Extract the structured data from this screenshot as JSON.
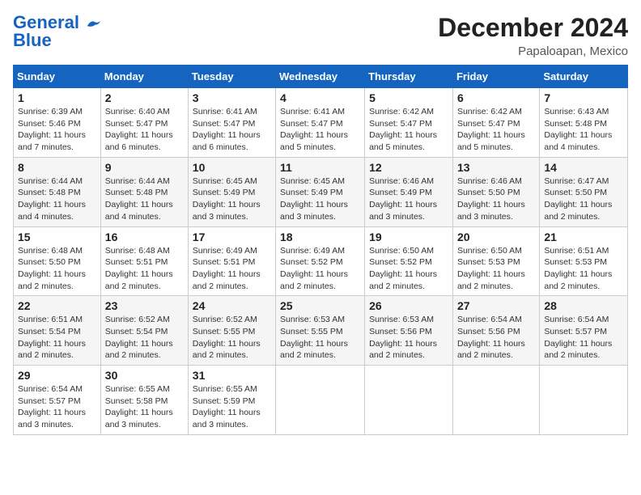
{
  "header": {
    "logo_line1": "General",
    "logo_line2": "Blue",
    "month": "December 2024",
    "location": "Papaloapan, Mexico"
  },
  "weekdays": [
    "Sunday",
    "Monday",
    "Tuesday",
    "Wednesday",
    "Thursday",
    "Friday",
    "Saturday"
  ],
  "weeks": [
    [
      {
        "day": "1",
        "sunrise": "6:39 AM",
        "sunset": "5:46 PM",
        "daylight": "11 hours and 7 minutes."
      },
      {
        "day": "2",
        "sunrise": "6:40 AM",
        "sunset": "5:47 PM",
        "daylight": "11 hours and 6 minutes."
      },
      {
        "day": "3",
        "sunrise": "6:41 AM",
        "sunset": "5:47 PM",
        "daylight": "11 hours and 6 minutes."
      },
      {
        "day": "4",
        "sunrise": "6:41 AM",
        "sunset": "5:47 PM",
        "daylight": "11 hours and 5 minutes."
      },
      {
        "day": "5",
        "sunrise": "6:42 AM",
        "sunset": "5:47 PM",
        "daylight": "11 hours and 5 minutes."
      },
      {
        "day": "6",
        "sunrise": "6:42 AM",
        "sunset": "5:47 PM",
        "daylight": "11 hours and 5 minutes."
      },
      {
        "day": "7",
        "sunrise": "6:43 AM",
        "sunset": "5:48 PM",
        "daylight": "11 hours and 4 minutes."
      }
    ],
    [
      {
        "day": "8",
        "sunrise": "6:44 AM",
        "sunset": "5:48 PM",
        "daylight": "11 hours and 4 minutes."
      },
      {
        "day": "9",
        "sunrise": "6:44 AM",
        "sunset": "5:48 PM",
        "daylight": "11 hours and 4 minutes."
      },
      {
        "day": "10",
        "sunrise": "6:45 AM",
        "sunset": "5:49 PM",
        "daylight": "11 hours and 3 minutes."
      },
      {
        "day": "11",
        "sunrise": "6:45 AM",
        "sunset": "5:49 PM",
        "daylight": "11 hours and 3 minutes."
      },
      {
        "day": "12",
        "sunrise": "6:46 AM",
        "sunset": "5:49 PM",
        "daylight": "11 hours and 3 minutes."
      },
      {
        "day": "13",
        "sunrise": "6:46 AM",
        "sunset": "5:50 PM",
        "daylight": "11 hours and 3 minutes."
      },
      {
        "day": "14",
        "sunrise": "6:47 AM",
        "sunset": "5:50 PM",
        "daylight": "11 hours and 2 minutes."
      }
    ],
    [
      {
        "day": "15",
        "sunrise": "6:48 AM",
        "sunset": "5:50 PM",
        "daylight": "11 hours and 2 minutes."
      },
      {
        "day": "16",
        "sunrise": "6:48 AM",
        "sunset": "5:51 PM",
        "daylight": "11 hours and 2 minutes."
      },
      {
        "day": "17",
        "sunrise": "6:49 AM",
        "sunset": "5:51 PM",
        "daylight": "11 hours and 2 minutes."
      },
      {
        "day": "18",
        "sunrise": "6:49 AM",
        "sunset": "5:52 PM",
        "daylight": "11 hours and 2 minutes."
      },
      {
        "day": "19",
        "sunrise": "6:50 AM",
        "sunset": "5:52 PM",
        "daylight": "11 hours and 2 minutes."
      },
      {
        "day": "20",
        "sunrise": "6:50 AM",
        "sunset": "5:53 PM",
        "daylight": "11 hours and 2 minutes."
      },
      {
        "day": "21",
        "sunrise": "6:51 AM",
        "sunset": "5:53 PM",
        "daylight": "11 hours and 2 minutes."
      }
    ],
    [
      {
        "day": "22",
        "sunrise": "6:51 AM",
        "sunset": "5:54 PM",
        "daylight": "11 hours and 2 minutes."
      },
      {
        "day": "23",
        "sunrise": "6:52 AM",
        "sunset": "5:54 PM",
        "daylight": "11 hours and 2 minutes."
      },
      {
        "day": "24",
        "sunrise": "6:52 AM",
        "sunset": "5:55 PM",
        "daylight": "11 hours and 2 minutes."
      },
      {
        "day": "25",
        "sunrise": "6:53 AM",
        "sunset": "5:55 PM",
        "daylight": "11 hours and 2 minutes."
      },
      {
        "day": "26",
        "sunrise": "6:53 AM",
        "sunset": "5:56 PM",
        "daylight": "11 hours and 2 minutes."
      },
      {
        "day": "27",
        "sunrise": "6:54 AM",
        "sunset": "5:56 PM",
        "daylight": "11 hours and 2 minutes."
      },
      {
        "day": "28",
        "sunrise": "6:54 AM",
        "sunset": "5:57 PM",
        "daylight": "11 hours and 2 minutes."
      }
    ],
    [
      {
        "day": "29",
        "sunrise": "6:54 AM",
        "sunset": "5:57 PM",
        "daylight": "11 hours and 3 minutes."
      },
      {
        "day": "30",
        "sunrise": "6:55 AM",
        "sunset": "5:58 PM",
        "daylight": "11 hours and 3 minutes."
      },
      {
        "day": "31",
        "sunrise": "6:55 AM",
        "sunset": "5:59 PM",
        "daylight": "11 hours and 3 minutes."
      },
      null,
      null,
      null,
      null
    ]
  ]
}
